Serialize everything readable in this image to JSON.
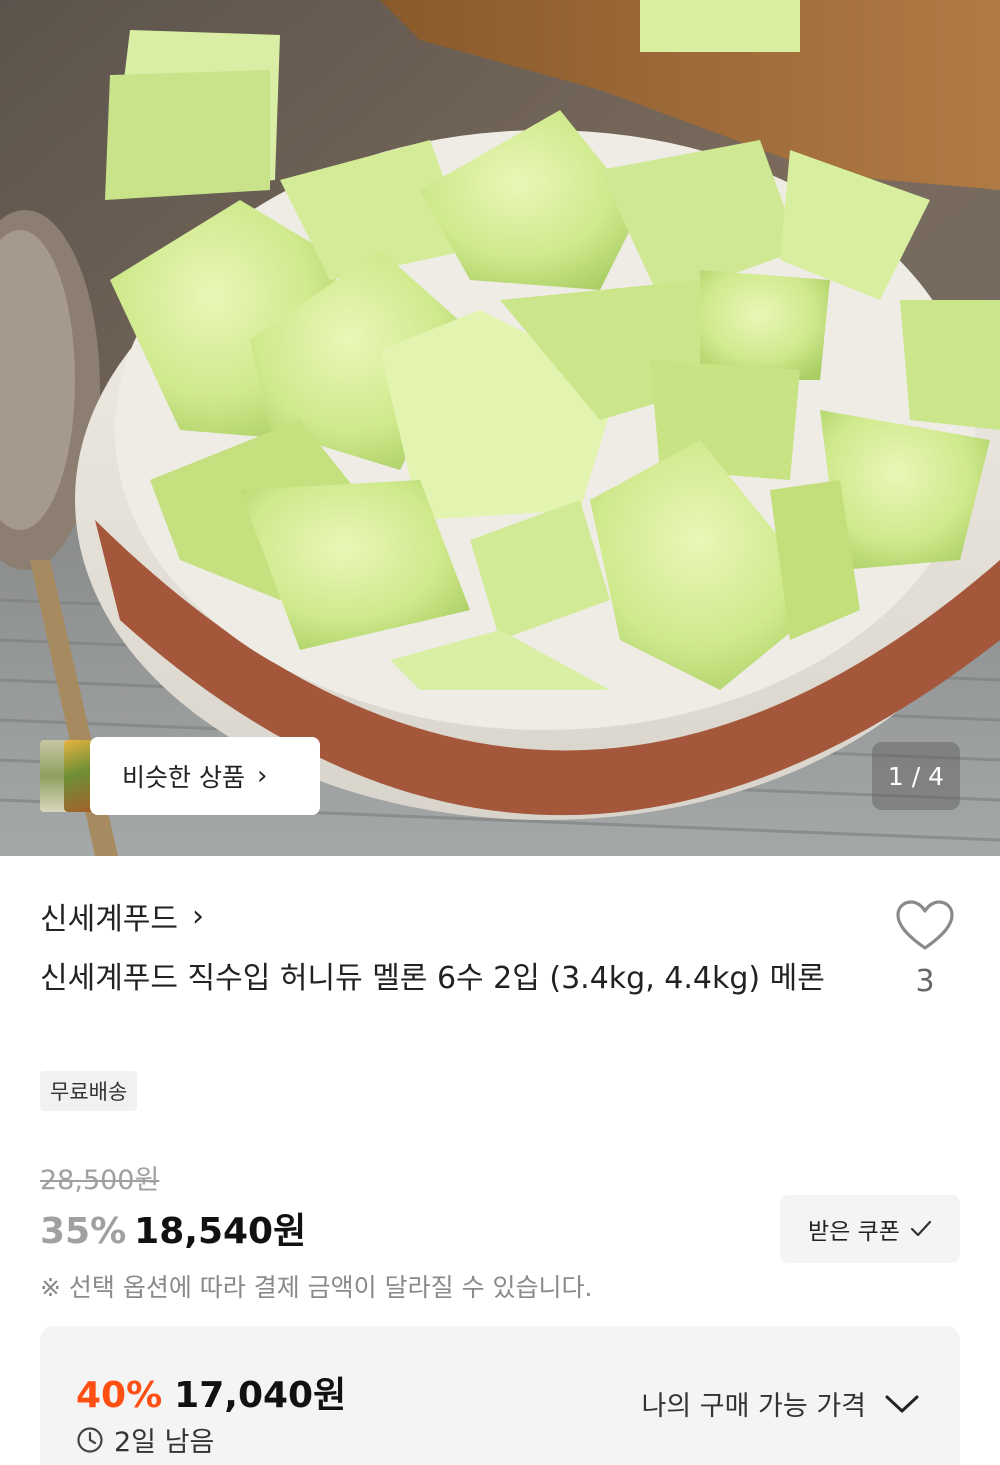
{
  "hero": {
    "similar_label": "비슷한 상품",
    "counter": "1 / 4"
  },
  "product": {
    "seller": "신세계푸드",
    "title": "신세계푸드 직수입 허니듀 멜론 6수 2입 (3.4kg, 4.4kg) 메론",
    "like_count": "3",
    "badge": "무료배송",
    "original_price": "28,500원",
    "discount_pct": "35%",
    "price": "18,540원",
    "coupon_label": "받은 쿠폰",
    "notice": "※ 선택 옵션에 따라 결제 금액이 달라질 수 있습니다."
  },
  "my_price": {
    "discount_pct": "40%",
    "price": "17,040원",
    "remaining": "2일 남음",
    "toggle_label": "나의 구매 가능 가격"
  },
  "colors": {
    "accent_orange": "#ff4f12",
    "muted_gray": "#a0a0a0",
    "panel_bg": "#f4f4f4"
  },
  "icons": [
    "chevron-right-icon",
    "heart-icon",
    "check-icon",
    "clock-icon",
    "chevron-down-icon"
  ]
}
